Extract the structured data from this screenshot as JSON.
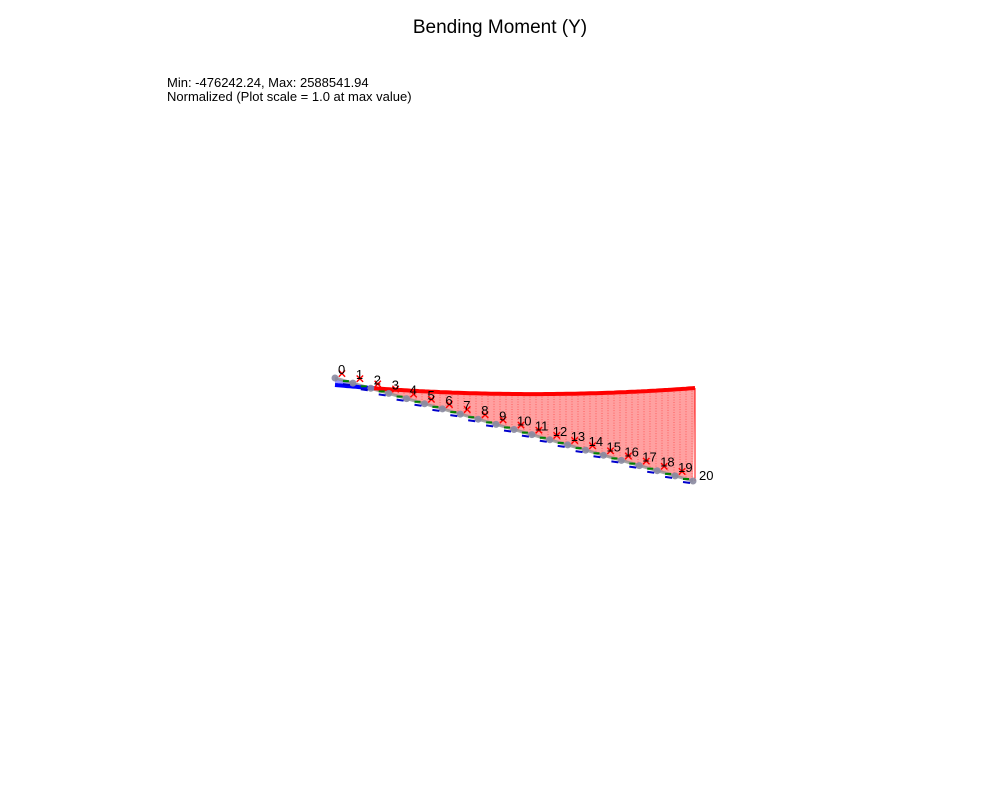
{
  "plot": {
    "title": "Bending Moment (Y)",
    "info_line_1": "Min: -476242.24, Max: 2588541.94",
    "info_line_2": "Normalized (Plot scale = 1.0 at max value)"
  },
  "results": {
    "min": -476242.24,
    "max": 2588541.94
  },
  "node_labels": [
    "0",
    "1",
    "2",
    "3",
    "4",
    "5",
    "6",
    "7",
    "8",
    "9",
    "10",
    "11",
    "12",
    "13",
    "14",
    "15",
    "16",
    "17",
    "18",
    "19",
    "20"
  ],
  "colors": {
    "positive_line": "#ff0000",
    "positive_fill": "#ff8080",
    "negative_line": "#0000ff",
    "negative_fill": "#8080ff",
    "beam": "#909090",
    "node_marker": "#8a8aa0",
    "load_marker": "#ff0000",
    "support_arrow_green": "#008000",
    "support_arrow_blue": "#0000cc"
  },
  "icons": {
    "load_marker": "x-mark-icon",
    "node_marker": "circle-node-icon",
    "local_axes": "axis-arrows-icon"
  }
}
